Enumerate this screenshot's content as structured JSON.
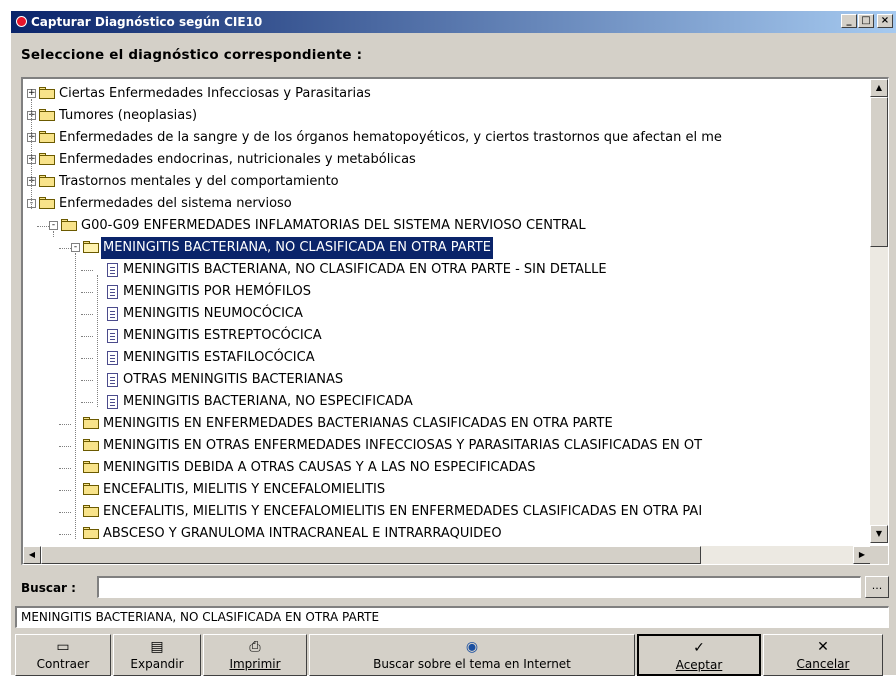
{
  "window": {
    "title": "Capturar Diagnóstico según CIE10",
    "controls": [
      "_",
      "□",
      "×"
    ]
  },
  "prompt": "Seleccione el diagnóstico correspondiente :",
  "tree": [
    {
      "label": "Ciertas Enfermedades Infecciosas y Parasitarias",
      "level": 0,
      "type": "folder",
      "expander": "+"
    },
    {
      "label": "Tumores (neoplasias)",
      "level": 0,
      "type": "folder",
      "expander": "+"
    },
    {
      "label": "Enfermedades de la sangre y de los órganos hematopoyéticos, y ciertos trastornos que afectan el me",
      "level": 0,
      "type": "folder",
      "expander": "+"
    },
    {
      "label": "Enfermedades endocrinas, nutricionales y metabólicas",
      "level": 0,
      "type": "folder",
      "expander": "+"
    },
    {
      "label": "Trastornos mentales y del comportamiento",
      "level": 0,
      "type": "folder",
      "expander": "+"
    },
    {
      "label": "Enfermedades del sistema nervioso",
      "level": 0,
      "type": "folder",
      "expander": "−"
    },
    {
      "label": "G00-G09 ENFERMEDADES INFLAMATORIAS DEL SISTEMA NERVIOSO CENTRAL",
      "level": 1,
      "type": "folder",
      "expander": "−"
    },
    {
      "label": "MENINGITIS BACTERIANA, NO CLASIFICADA EN OTRA PARTE",
      "level": 2,
      "type": "folder-open",
      "expander": "−",
      "selected": true
    },
    {
      "label": "MENINGITIS BACTERIANA, NO CLASIFICADA EN OTRA PARTE - SIN DETALLE",
      "level": 3,
      "type": "doc"
    },
    {
      "label": "MENINGITIS POR HEMÓFILOS",
      "level": 3,
      "type": "doc"
    },
    {
      "label": "MENINGITIS NEUMOCÓCICA",
      "level": 3,
      "type": "doc"
    },
    {
      "label": "MENINGITIS ESTREPTOCÓCICA",
      "level": 3,
      "type": "doc"
    },
    {
      "label": "MENINGITIS ESTAFILOCÓCICA",
      "level": 3,
      "type": "doc"
    },
    {
      "label": "OTRAS MENINGITIS BACTERIANAS",
      "level": 3,
      "type": "doc"
    },
    {
      "label": "MENINGITIS BACTERIANA, NO ESPECIFICADA",
      "level": 3,
      "type": "doc"
    },
    {
      "label": "MENINGITIS EN ENFERMEDADES BACTERIANAS CLASIFICADAS EN OTRA PARTE",
      "level": 2,
      "type": "folder"
    },
    {
      "label": "MENINGITIS EN OTRAS ENFERMEDADES INFECCIOSAS Y PARASITARIAS CLASIFICADAS EN OT",
      "level": 2,
      "type": "folder"
    },
    {
      "label": "MENINGITIS DEBIDA A OTRAS CAUSAS Y A LAS NO ESPECIFICADAS",
      "level": 2,
      "type": "folder"
    },
    {
      "label": "ENCEFALITIS, MIELITIS Y ENCEFALOMIELITIS",
      "level": 2,
      "type": "folder"
    },
    {
      "label": "ENCEFALITIS, MIELITIS Y ENCEFALOMIELITIS EN ENFERMEDADES CLASIFICADAS EN OTRA PAI",
      "level": 2,
      "type": "folder"
    },
    {
      "label": "ABSCESO Y GRANULOMA INTRACRANEAL E INTRARRAQUIDEO",
      "level": 2,
      "type": "folder"
    }
  ],
  "search": {
    "label": "Buscar :",
    "value": "",
    "browse_label": "..."
  },
  "selected_text": "MENINGITIS BACTERIANA, NO CLASIFICADA EN OTRA PARTE",
  "buttons": {
    "collapse": "Contraer",
    "expand": "Expandir",
    "print": "Imprimir",
    "web_search": "Buscar sobre el tema en Internet",
    "accept": "Aceptar",
    "cancel": "Cancelar"
  },
  "icons": {
    "collapse": "folder-collapse-icon",
    "expand": "folder-expand-icon",
    "print": "printer-icon",
    "web_search": "globe-search-icon",
    "accept": "check-icon",
    "cancel": "x-icon"
  }
}
